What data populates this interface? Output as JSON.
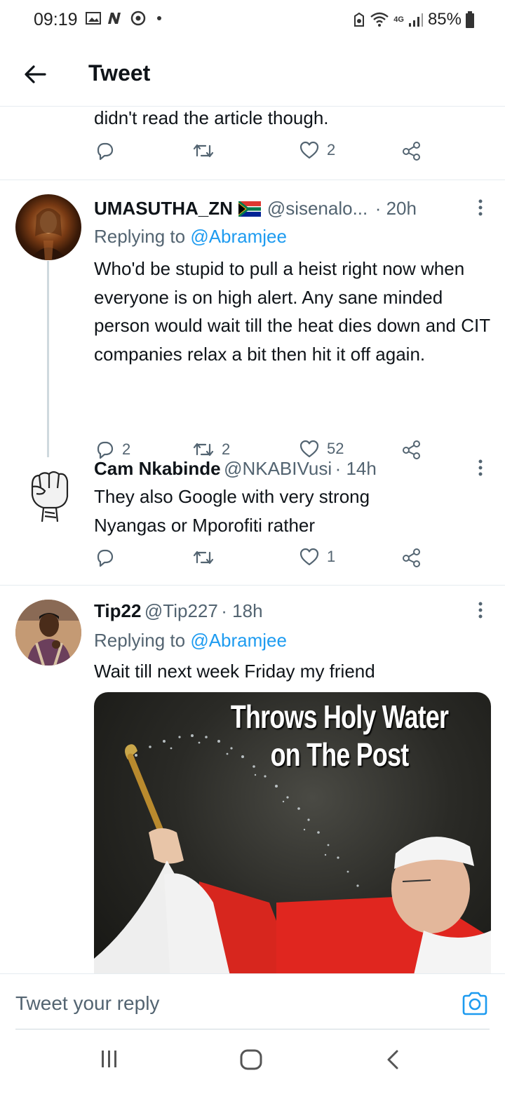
{
  "status_bar": {
    "time": "09:19",
    "battery": "85%",
    "network": "4G"
  },
  "header": {
    "title": "Tweet"
  },
  "tweets": [
    {
      "text": "didn't read the article though.",
      "replies": "",
      "retweets": "",
      "likes": "2"
    },
    {
      "name": "UMASUTHA_ZN",
      "handle": "@sisenalo...",
      "time": "· 20h",
      "replying_prefix": "Replying to",
      "replying_to": "@Abramjee",
      "text": "Who'd be stupid to pull a heist right now when everyone is on high alert. Any sane minded person would wait till the heat dies down and CIT companies relax a bit then hit it off again.",
      "replies": "2",
      "retweets": "2",
      "likes": "52"
    },
    {
      "name": "Cam Nkabinde",
      "handle": "@NKABIVusi",
      "time": "· 14h",
      "text": "They also Google with very strong Nyangas or Mporofiti rather",
      "replies": "",
      "retweets": "",
      "likes": "1"
    },
    {
      "name": "Tip22",
      "handle": "@Tip227",
      "time": "· 18h",
      "replying_prefix": "Replying to",
      "replying_to": "@Abramjee",
      "text": "Wait till next week Friday my friend",
      "meme_line1": "Throws Holy Water",
      "meme_line2": "on The Post"
    }
  ],
  "reply_bar": {
    "placeholder": "Tweet your reply"
  },
  "colors": {
    "accent": "#1d9bf0",
    "text": "#0f1419",
    "secondary": "#536471",
    "divider": "#e6ecf0"
  }
}
